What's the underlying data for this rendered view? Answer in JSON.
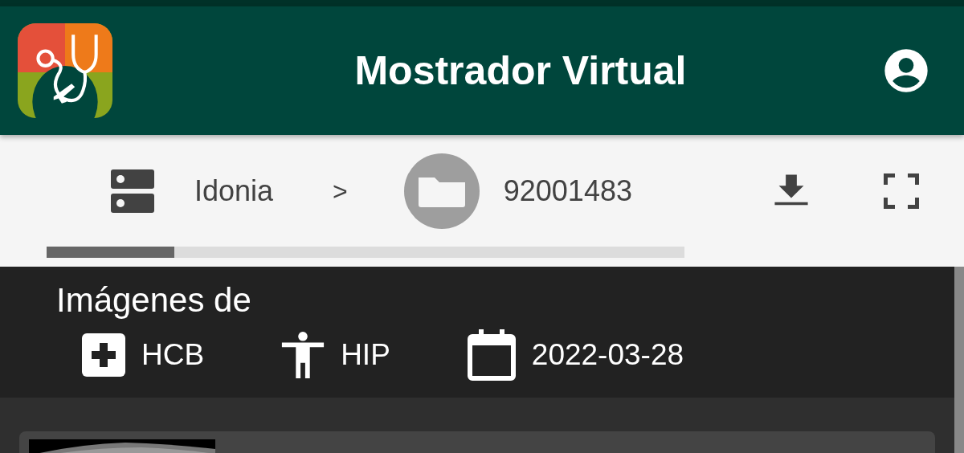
{
  "app_bar": {
    "title": "Mostrador Virtual"
  },
  "breadcrumb": {
    "items": [
      {
        "kind": "server",
        "label": "Idonia"
      },
      {
        "kind": "folder",
        "label": "92001483"
      }
    ],
    "separator": ">"
  },
  "progress": {
    "level": 0.2
  },
  "study": {
    "heading": "Imágenes de",
    "facts": [
      {
        "kind": "hospital",
        "label": "HCB"
      },
      {
        "kind": "body",
        "label": "HIP"
      },
      {
        "kind": "date",
        "label": "2022-03-28"
      }
    ]
  }
}
